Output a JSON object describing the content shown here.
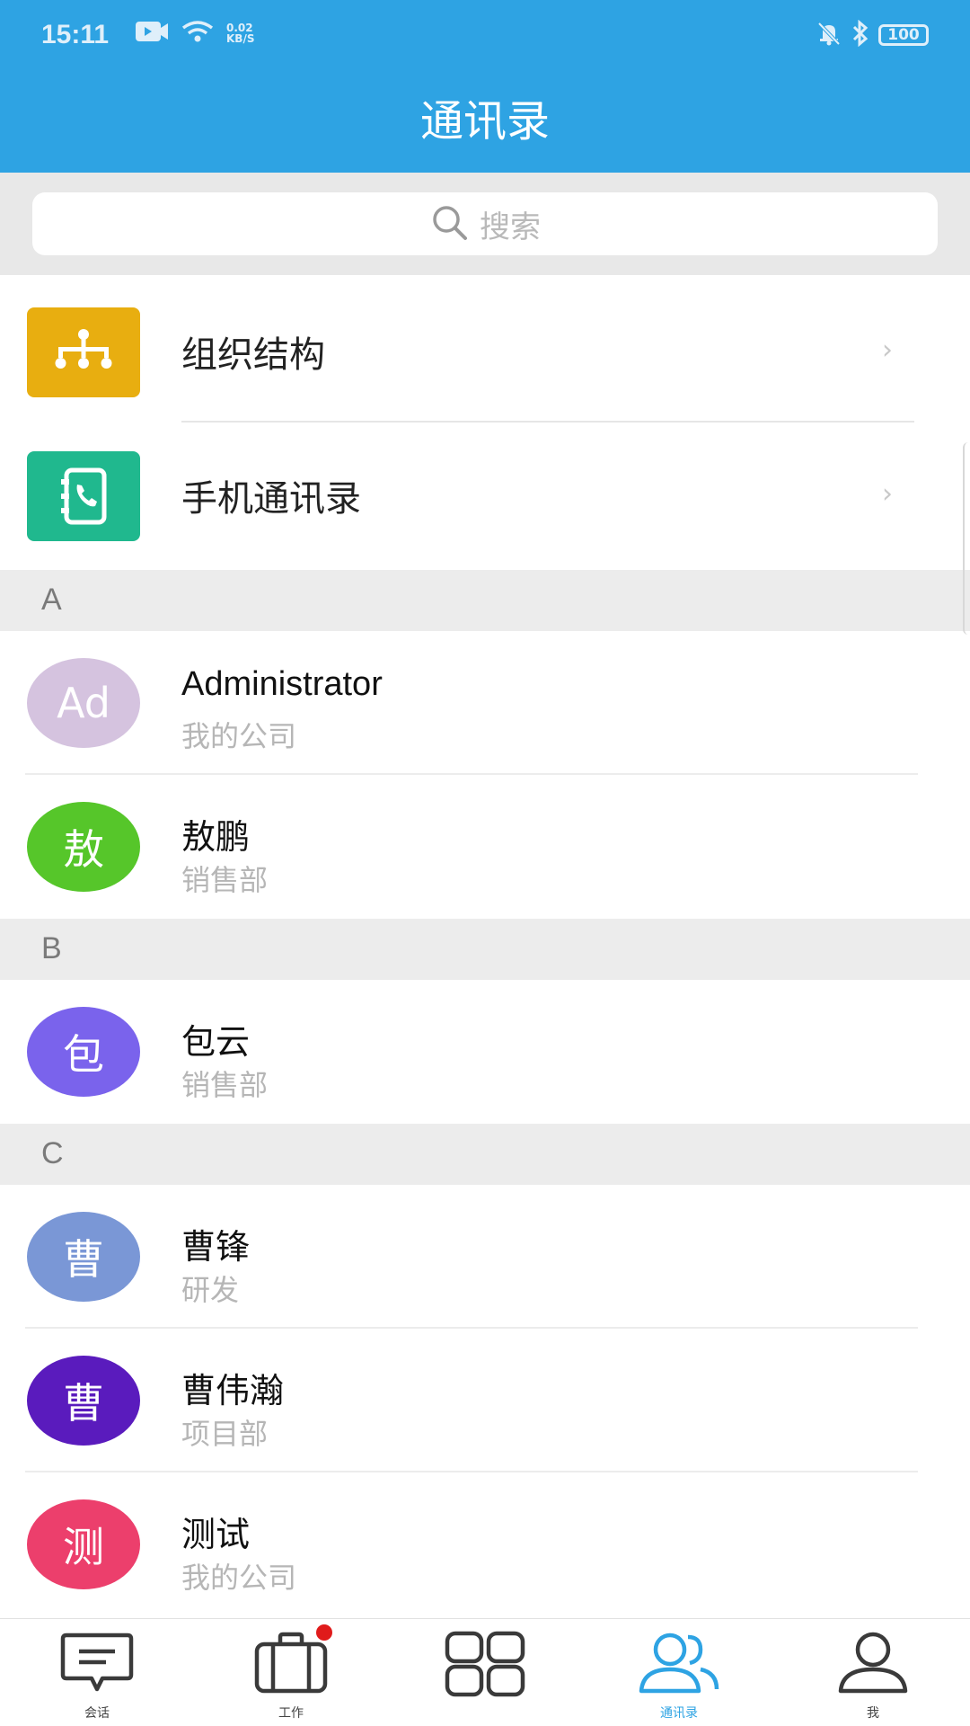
{
  "status_bar": {
    "time": "15:11",
    "speed_value": "0.02",
    "speed_unit": "KB/S",
    "battery": "100"
  },
  "header": {
    "title": "通讯录"
  },
  "search": {
    "placeholder": "搜索"
  },
  "entries": [
    {
      "label": "组织结构",
      "icon": "org-structure-icon",
      "color": "#e8ae10"
    },
    {
      "label": "手机通讯录",
      "icon": "phone-book-icon",
      "color": "#20b88e"
    }
  ],
  "sections": [
    {
      "letter": "A",
      "contacts": [
        {
          "avatar_text": "Ad",
          "name": "Administrator",
          "dept": "我的公司",
          "color": "#d5c3df"
        },
        {
          "avatar_text": "敖",
          "name": "敖鹏",
          "dept": "销售部",
          "color": "#56c62a"
        }
      ]
    },
    {
      "letter": "B",
      "contacts": [
        {
          "avatar_text": "包",
          "name": "包云",
          "dept": "销售部",
          "color": "#7a63ec"
        }
      ]
    },
    {
      "letter": "C",
      "contacts": [
        {
          "avatar_text": "曹",
          "name": "曹锋",
          "dept": "研发",
          "color": "#7a97d6"
        },
        {
          "avatar_text": "曹",
          "name": "曹伟瀚",
          "dept": "项目部",
          "color": "#5a1bbd"
        },
        {
          "avatar_text": "测",
          "name": "测试",
          "dept": "我的公司",
          "color": "#ec3f6c"
        }
      ]
    }
  ],
  "tabbar": {
    "tabs": [
      {
        "label": "会话",
        "icon": "message-icon",
        "active": false,
        "badge": false
      },
      {
        "label": "工作",
        "icon": "briefcase-icon",
        "active": false,
        "badge": true
      },
      {
        "label": "",
        "icon": "apps-grid-icon",
        "active": false,
        "badge": false
      },
      {
        "label": "通讯录",
        "icon": "contacts-icon",
        "active": true,
        "badge": false
      },
      {
        "label": "我",
        "icon": "profile-icon",
        "active": false,
        "badge": false
      }
    ],
    "active_color": "#2ea3e3",
    "inactive_color": "#3a3a3a"
  }
}
